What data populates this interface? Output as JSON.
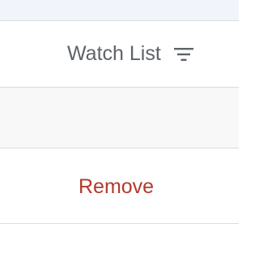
{
  "table": {
    "column_header": {
      "label": "Watch List",
      "icon": "filter-icon"
    },
    "rows": [
      {
        "action_label": ""
      },
      {
        "action_label": "Remove"
      }
    ]
  },
  "colors": {
    "header_text": "#5f6368",
    "remove_text": "#b03a2e",
    "top_strip_bg": "#f1f4fa",
    "empty_row_bg": "#f8f8f8",
    "divider": "#dcdcdc"
  }
}
